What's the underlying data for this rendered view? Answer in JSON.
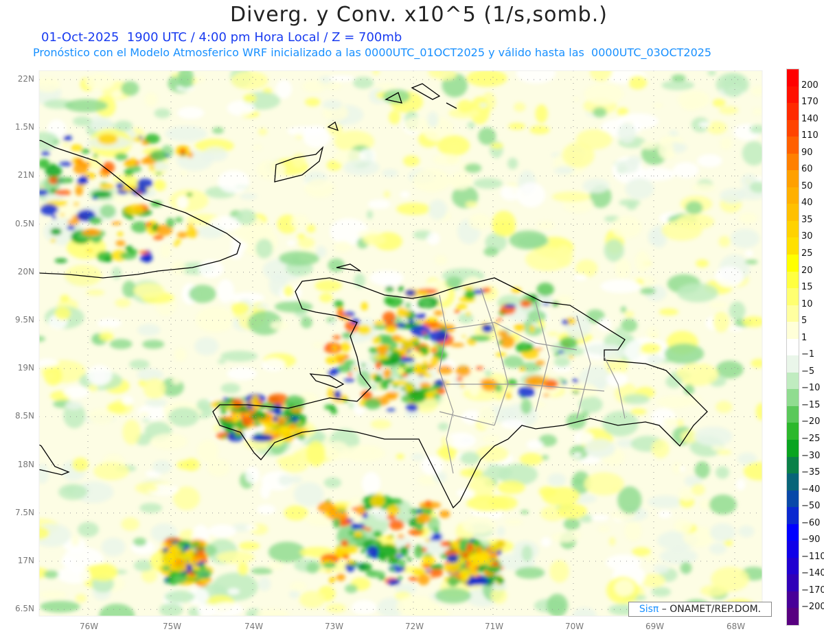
{
  "header": {
    "title": "Diverg. y Conv. x10^5 (1/s,somb.)",
    "subtitle_1": "01-Oct-2025  1900 UTC / 4:00 pm Hora Local / Z = 700mb",
    "subtitle_2": "Pronóstico con el Modelo Atmosferico WRF inicializado a las 0000UTC_01OCT2025 y válido hasta las  0000UTC_03OCT2025"
  },
  "axes": {
    "lon_labels": [
      "76W",
      "75W",
      "74W",
      "73W",
      "72W",
      "71W",
      "70W",
      "69W",
      "68W"
    ],
    "lat_labels": [
      "22N",
      "1.5N",
      "21N",
      "0.5N",
      "20N",
      "9.5N",
      "19N",
      "8.5N",
      "18N",
      "7.5N",
      "17N",
      "6.5N"
    ]
  },
  "colorbar": {
    "labels": [
      "200",
      "170",
      "140",
      "110",
      "90",
      "60",
      "50",
      "40",
      "35",
      "30",
      "25",
      "20",
      "15",
      "10",
      "5",
      "1",
      "−1",
      "−5",
      "−10",
      "−15",
      "−20",
      "−25",
      "−30",
      "−35",
      "−40",
      "−50",
      "−60",
      "−90",
      "−110",
      "−140",
      "−170",
      "−200"
    ],
    "colors": [
      "#ff0000",
      "#ff1000",
      "#ff2a00",
      "#ff4400",
      "#ff6000",
      "#ff8000",
      "#ffa000",
      "#ffb000",
      "#ffc000",
      "#ffd200",
      "#ffe000",
      "#ffff00",
      "#ffff40",
      "#ffff70",
      "#ffffa0",
      "#ffffd8",
      "#ffffff",
      "#eaf6ea",
      "#c0ecc0",
      "#90dc90",
      "#5ac85a",
      "#2cb82c",
      "#08a420",
      "#0a8048",
      "#086478",
      "#0848a8",
      "#0a28d0",
      "#0000ff",
      "#1000e8",
      "#2000d0",
      "#3000b8",
      "#480098",
      "#580080"
    ]
  },
  "credit": {
    "brand": "Sisπ",
    "text": " – ONAMET/REP.DOM."
  }
}
